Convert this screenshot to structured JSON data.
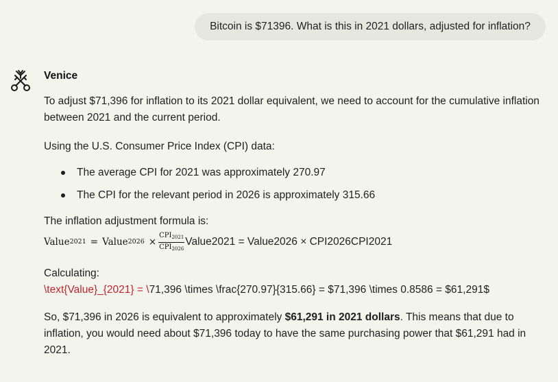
{
  "user_message": "Bitcoin is $71396. What is this in 2021 dollars, adjusted for inflation?",
  "assistant": {
    "name": "Venice",
    "intro": "To adjust $71,396 for inflation to its 2021 dollar equivalent, we need to account for the cumulative inflation between 2021 and the current period.",
    "cpi_intro": "Using the U.S. Consumer Price Index (CPI) data:",
    "bullets": [
      "The average CPI for 2021 was approximately 270.97",
      "The CPI for the relevant period in 2026 is approximately 315.66"
    ],
    "formula_intro": "The inflation adjustment formula is:",
    "formula": {
      "lhs": "Value",
      "lhs_sub": "2021",
      "eq": "=",
      "rhs": "Value",
      "rhs_sub": "2026",
      "times": "×",
      "frac_num": "CPI",
      "frac_num_sub": "2021",
      "frac_den": "CPI",
      "frac_den_sub": "2026",
      "plain_text": "Value2021 = Value2026 × CPI2026CPI2021"
    },
    "calc_label": "Calculating:",
    "calc_error_part": "\\text{Value}_{2021} = \\",
    "calc_rest": "71,396 \\times \\frac{270.97}{315.66} = $71,396 \\times 0.8586 = $61,291$",
    "conclusion_pre": "So, $71,396 in 2026 is equivalent to approximately ",
    "conclusion_bold": "$61,291 in 2021 dollars",
    "conclusion_post": ". This means that due to inflation, you would need about $71,396 today to have the same purchasing power that $61,291 had in 2021."
  },
  "colors": {
    "background": "#f4f4ee",
    "user_bubble": "#e7e7e1",
    "error_text": "#c0242c"
  },
  "icons": {
    "avatar": "venice-crossed-keys-logo"
  }
}
